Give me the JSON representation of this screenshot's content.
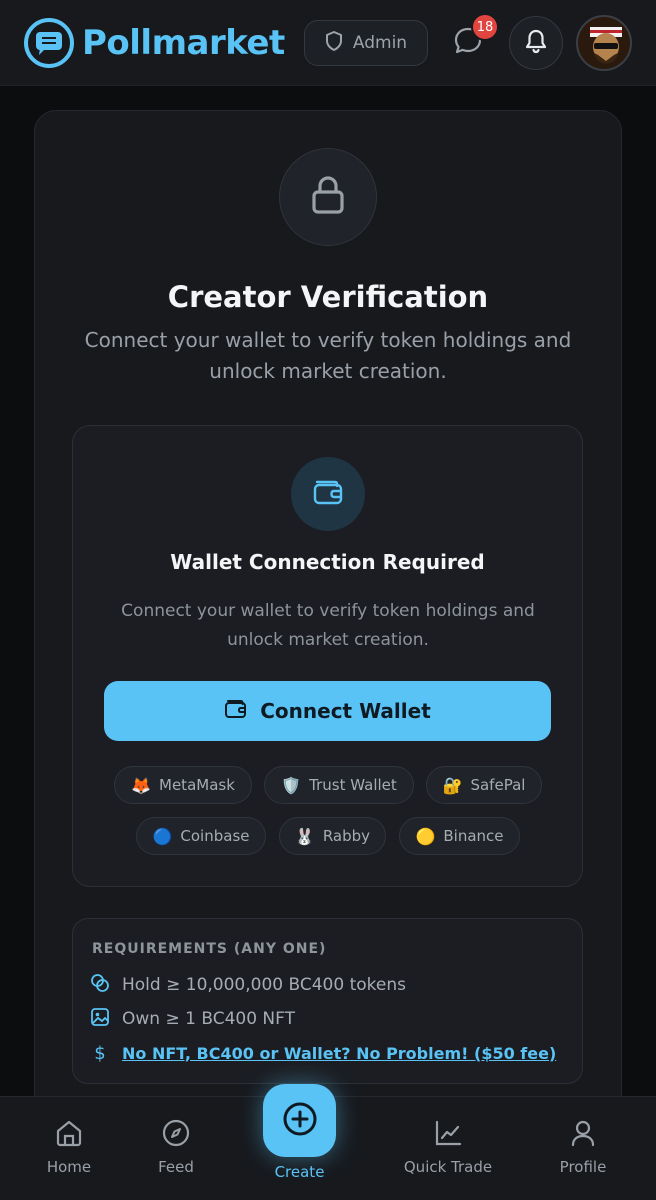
{
  "header": {
    "brand": "Pollmarket",
    "admin_label": "Admin",
    "chat_badge_count": "18",
    "icons": [
      "logo-icon",
      "shield-icon",
      "chat-icon",
      "bell-icon",
      "avatar"
    ]
  },
  "main": {
    "title": "Creator Verification",
    "subtitle": "Connect your wallet to verify token holdings and unlock market creation.",
    "icon": "lock-icon"
  },
  "wallet": {
    "title": "Wallet Connection Required",
    "description": "Connect your wallet to verify token holdings and unlock market creation.",
    "connect_label": "Connect Wallet",
    "providers": [
      {
        "emoji": "🦊",
        "label": "MetaMask"
      },
      {
        "emoji": "🛡️",
        "label": "Trust Wallet"
      },
      {
        "emoji": "🔐",
        "label": "SafePal"
      },
      {
        "emoji": "🔵",
        "label": "Coinbase"
      },
      {
        "emoji": "🐰",
        "label": "Rabby"
      },
      {
        "emoji": "🟡",
        "label": "Binance"
      }
    ]
  },
  "requirements": {
    "title": "REQUIREMENTS (ANY ONE)",
    "items": [
      {
        "icon": "coins-icon",
        "text": "Hold ≥ 10,000,000 BC400 tokens"
      },
      {
        "icon": "image-icon",
        "text": "Own ≥ 1 BC400 NFT"
      },
      {
        "icon": "dollar-icon",
        "text": "No NFT, BC400 or Wallet? No Problem! ($50 fee)"
      }
    ]
  },
  "nav": {
    "home": "Home",
    "feed": "Feed",
    "create": "Create",
    "quick_trade": "Quick Trade",
    "profile": "Profile"
  },
  "colors": {
    "accent": "#59c3f5",
    "badge": "#e0453f",
    "background": "#0c0d0f",
    "card": "#17191d"
  }
}
